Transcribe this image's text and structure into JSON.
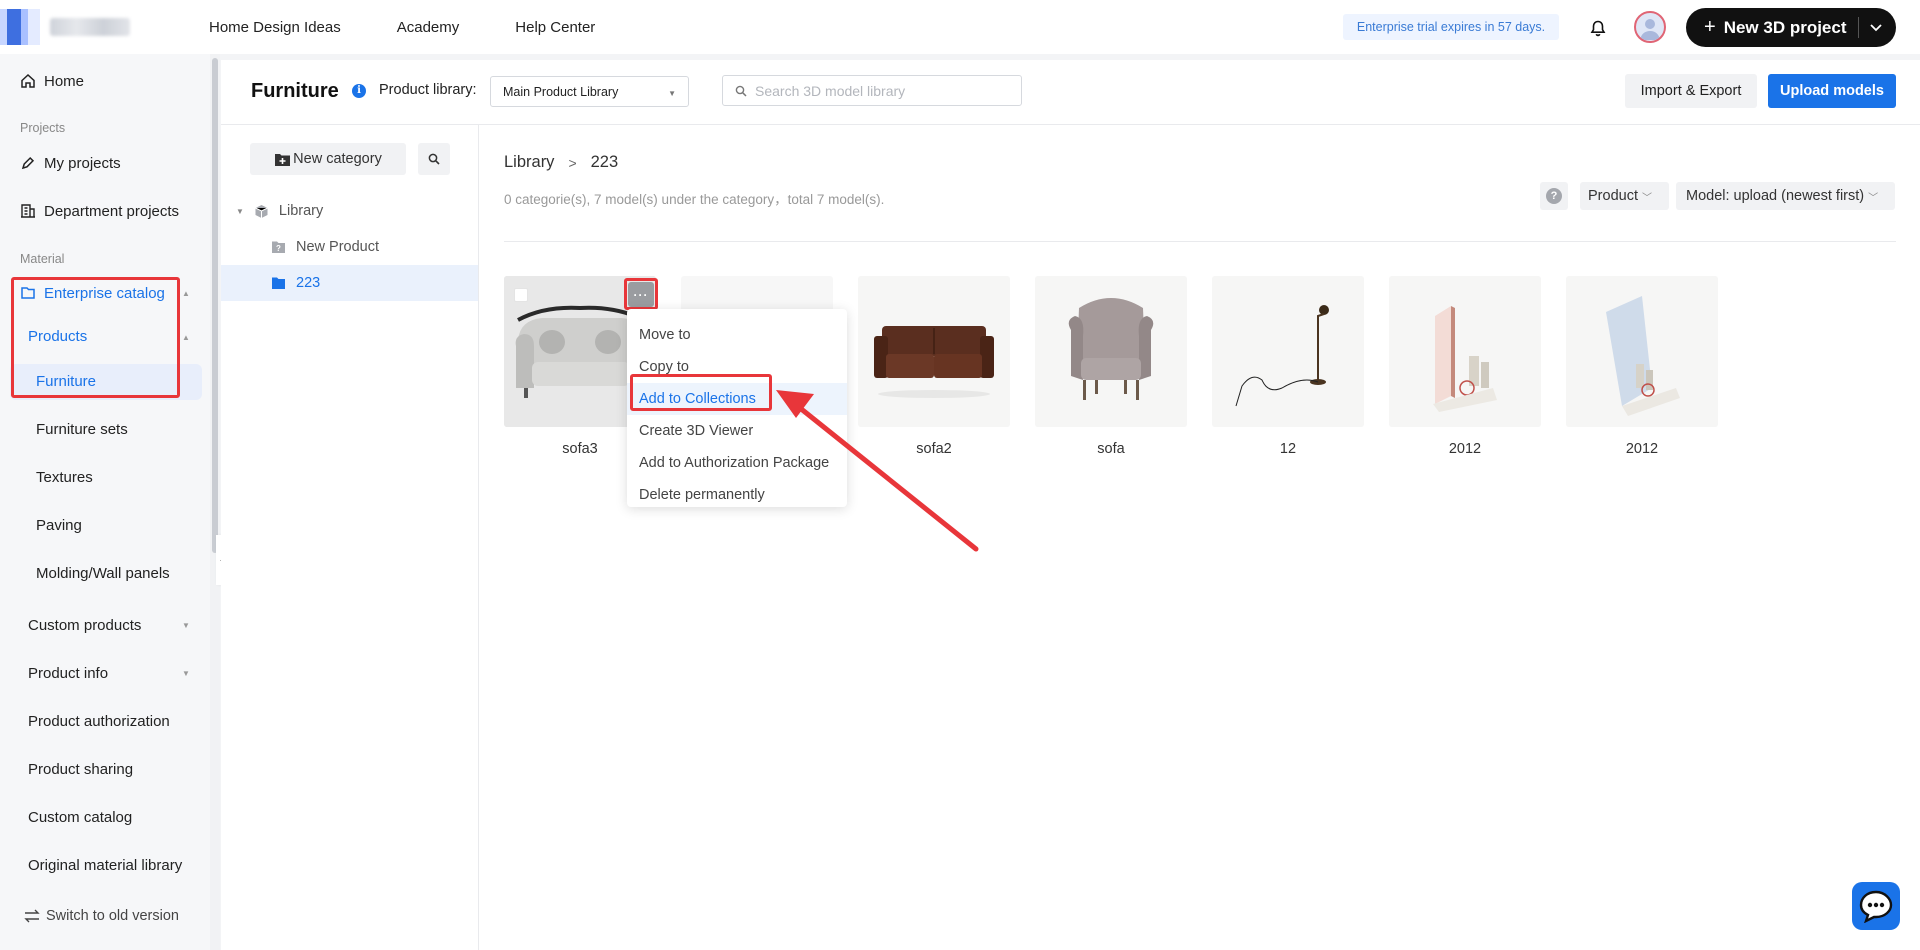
{
  "topnav": {
    "links": [
      "Home Design Ideas",
      "Academy",
      "Help Center"
    ],
    "trial": "Enterprise trial expires in 57 days.",
    "new_project": "New 3D project"
  },
  "sidebar": {
    "home": "Home",
    "group_projects": "Projects",
    "my_projects": "My projects",
    "department_projects": "Department projects",
    "group_material": "Material",
    "enterprise_catalog": "Enterprise catalog",
    "products": "Products",
    "furniture": "Furniture",
    "furniture_sets": "Furniture sets",
    "textures": "Textures",
    "paving": "Paving",
    "molding": "Molding/Wall panels",
    "custom_products": "Custom products",
    "product_info": "Product info",
    "product_authorization": "Product authorization",
    "product_sharing": "Product sharing",
    "custom_catalog": "Custom catalog",
    "original_material_library": "Original material library",
    "switch_old": "Switch to old version"
  },
  "header": {
    "title": "Furniture",
    "library_label": "Product library:",
    "library_value": "Main Product Library",
    "search_placeholder": "Search 3D model library",
    "import_export": "Import & Export",
    "upload_models": "Upload models"
  },
  "tree": {
    "new_category": "New category",
    "root": "Library",
    "items": [
      "New Product",
      "223"
    ]
  },
  "content": {
    "breadcrumb": [
      "Library",
      "223"
    ],
    "summary": "0 categorie(s), 7 model(s) under the category，total 7 model(s).",
    "filter_product": "Product",
    "sort": "Model: upload (newest first)",
    "models": [
      "sofa3",
      "",
      "sofa2",
      "sofa",
      "12",
      "2012",
      "2012"
    ]
  },
  "context_menu": {
    "trigger": "···",
    "items": [
      "Move to",
      "Copy to",
      "Add to Collections",
      "Create 3D Viewer",
      "Add to Authorization Package",
      "Delete permanently"
    ]
  },
  "colors": {
    "accent": "#1a73e8",
    "annotation": "#e8363a"
  }
}
